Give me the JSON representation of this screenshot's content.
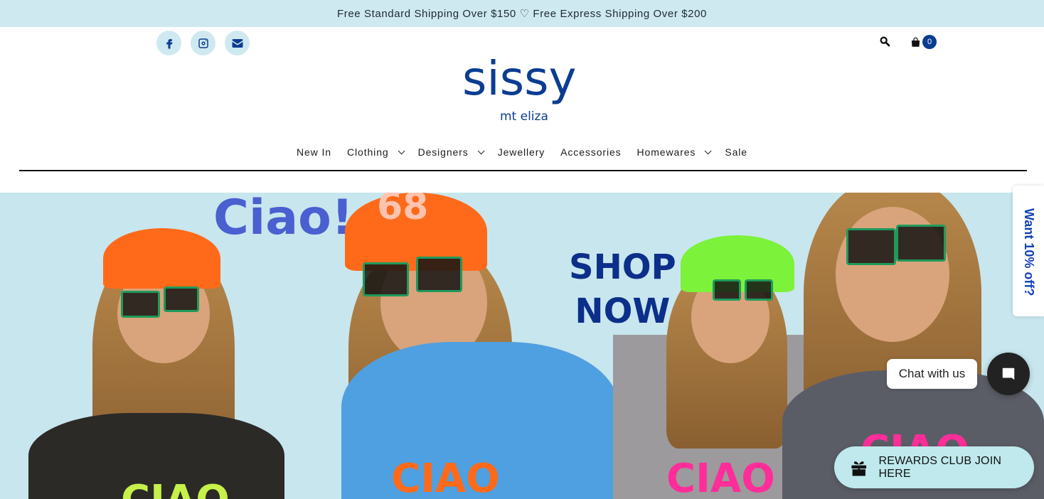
{
  "announcement": "Free Standard Shipping Over $150 ♡ Free Express Shipping Over $200",
  "social": [
    {
      "name": "facebook-icon"
    },
    {
      "name": "instagram-icon"
    },
    {
      "name": "envelope-icon"
    }
  ],
  "header": {
    "cart_count": "0",
    "logo_main": "sissy",
    "logo_sub": "mt eliza"
  },
  "nav": {
    "items": [
      {
        "label": "New In",
        "dropdown": false
      },
      {
        "label": "Clothing",
        "dropdown": true
      },
      {
        "label": "Designers",
        "dropdown": true
      },
      {
        "label": "Jewellery",
        "dropdown": false
      },
      {
        "label": "Accessories",
        "dropdown": false
      },
      {
        "label": "Homewares",
        "dropdown": true
      },
      {
        "label": "Sale",
        "dropdown": false
      }
    ]
  },
  "hero": {
    "headline": "Ciao!",
    "cta_line1": "SHOP",
    "cta_line2": "NOW",
    "cap_number": "68",
    "shirt_print": "CIAO"
  },
  "widgets": {
    "discount_tab": "Want 10% off?",
    "chat_label": "Chat with us",
    "rewards_label": "REWARDS CLUB JOIN HERE"
  },
  "colors": {
    "brand_blue": "#0b3d91",
    "announcement_bg": "#cfe9f0",
    "hero_bg": "#c8e6ee",
    "rewards_bg": "#bfe9ec"
  }
}
